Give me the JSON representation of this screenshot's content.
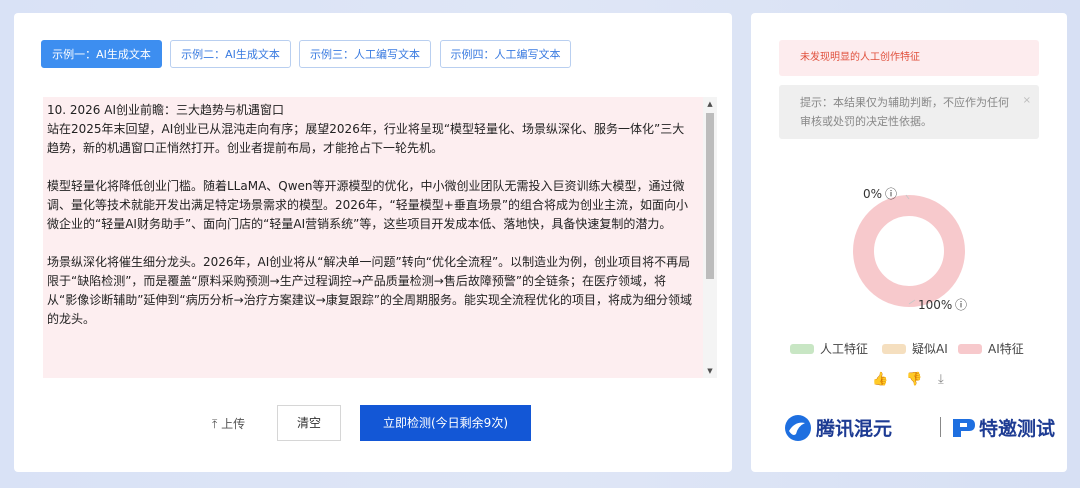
{
  "tabs": [
    {
      "label": "示例一：AI生成文本",
      "active": true
    },
    {
      "label": "示例二：AI生成文本",
      "active": false
    },
    {
      "label": "示例三：人工编写文本",
      "active": false
    },
    {
      "label": "示例四：人工编写文本",
      "active": false
    }
  ],
  "editor": {
    "text": "10. 2026 AI创业前瞻：三大趋势与机遇窗口\n站在2025年末回望，AI创业已从混沌走向有序；展望2026年，行业将呈现“模型轻量化、场景纵深化、服务一体化”三大趋势，新的机遇窗口正悄然打开。创业者提前布局，才能抢占下一轮先机。\n\n模型轻量化将降低创业门槛。随着LLaMA、Qwen等开源模型的优化，中小微创业团队无需投入巨资训练大模型，通过微调、量化等技术就能开发出满足特定场景需求的模型。2026年，“轻量模型+垂直场景”的组合将成为创业主流，如面向小微企业的“轻量AI财务助手”、面向门店的“轻量AI营销系统”等，这些项目开发成本低、落地快，具备快速复制的潜力。\n\n场景纵深化将催生细分龙头。2026年，AI创业将从“解决单一问题”转向“优化全流程”。以制造业为例，创业项目将不再局限于“缺陷检测”，而是覆盖“原料采购预测→生产过程调控→产品质量检测→售后故障预警”的全链条；在医疗领域，将从“影像诊断辅助”延伸到“病历分析→治疗方案建议→康复跟踪”的全周期服务。能实现全流程优化的项目，将成为细分领域的龙头。"
  },
  "actions": {
    "upload_label": "⤒ 上传",
    "clear_label": "清空",
    "detect_label": "立即检测(今日剩余9次)"
  },
  "result": {
    "alert": "未发现明显的人工创作特征",
    "tip": "提示：本结果仅为辅助判断，不应作为任何审核或处罚的决定性依据。",
    "tip_close": "×"
  },
  "chart_data": {
    "type": "pie",
    "donut": true,
    "labels": [
      "人工特征",
      "疑似AI",
      "AI特征"
    ],
    "values": [
      0,
      0,
      100
    ],
    "colors": [
      "#c8e6c4",
      "#f5dfbf",
      "#f7c9cc"
    ],
    "slice_labels": [
      "0%",
      "100%"
    ],
    "info_glyph": "ⓘ",
    "legend_position": "bottom"
  },
  "feedback": {
    "like": "👍",
    "dislike": "👎",
    "download": "⤓"
  },
  "brand": {
    "left": "腾讯混元",
    "right": "特邀测试"
  }
}
